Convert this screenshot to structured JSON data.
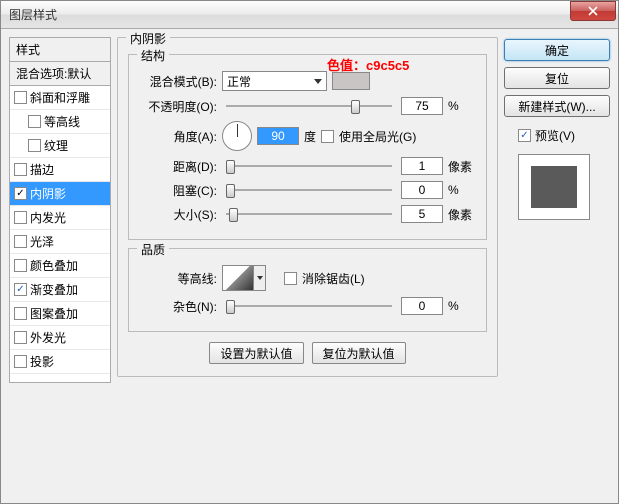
{
  "window": {
    "title": "图层样式"
  },
  "annotation": "色值：c9c5c5",
  "left": {
    "header": "样式",
    "blend": "混合选项:默认",
    "items": [
      {
        "label": "斜面和浮雕",
        "checked": false,
        "indent": false
      },
      {
        "label": "等高线",
        "checked": false,
        "indent": true
      },
      {
        "label": "纹理",
        "checked": false,
        "indent": true
      },
      {
        "label": "描边",
        "checked": false,
        "indent": false
      },
      {
        "label": "内阴影",
        "checked": true,
        "indent": false,
        "selected": true
      },
      {
        "label": "内发光",
        "checked": false,
        "indent": false
      },
      {
        "label": "光泽",
        "checked": false,
        "indent": false
      },
      {
        "label": "颜色叠加",
        "checked": false,
        "indent": false
      },
      {
        "label": "渐变叠加",
        "checked": true,
        "indent": false
      },
      {
        "label": "图案叠加",
        "checked": false,
        "indent": false
      },
      {
        "label": "外发光",
        "checked": false,
        "indent": false
      },
      {
        "label": "投影",
        "checked": false,
        "indent": false
      }
    ]
  },
  "center": {
    "panel_title": "内阴影",
    "structure": {
      "title": "结构",
      "blend_mode_label": "混合模式(B):",
      "blend_mode_value": "正常",
      "opacity_label": "不透明度(O):",
      "opacity_value": "75",
      "opacity_unit": "%",
      "angle_label": "角度(A):",
      "angle_value": "90",
      "angle_unit": "度",
      "global_light": "使用全局光(G)",
      "distance_label": "距离(D):",
      "distance_value": "1",
      "distance_unit": "像素",
      "choke_label": "阻塞(C):",
      "choke_value": "0",
      "choke_unit": "%",
      "size_label": "大小(S):",
      "size_value": "5",
      "size_unit": "像素"
    },
    "quality": {
      "title": "品质",
      "contour_label": "等高线:",
      "antialias": "消除锯齿(L)",
      "noise_label": "杂色(N):",
      "noise_value": "0",
      "noise_unit": "%"
    },
    "buttons": {
      "default": "设置为默认值",
      "reset": "复位为默认值"
    }
  },
  "right": {
    "ok": "确定",
    "cancel": "复位",
    "new_style": "新建样式(W)...",
    "preview": "预览(V)"
  }
}
